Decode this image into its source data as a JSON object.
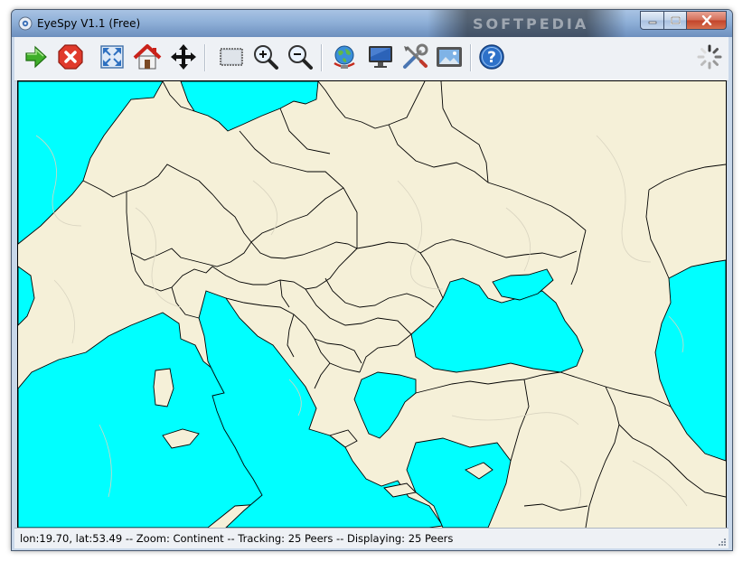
{
  "window": {
    "title": "EyeSpy V1.1 (Free)"
  },
  "watermark": "SOFTPEDIA",
  "toolbar": {
    "buttons": [
      {
        "name": "start",
        "icon": "green-arrow-right-icon"
      },
      {
        "name": "stop",
        "icon": "red-x-icon"
      },
      {
        "name": "full-extent",
        "icon": "expand-icon"
      },
      {
        "name": "home",
        "icon": "home-icon"
      },
      {
        "name": "pan",
        "icon": "move-arrows-icon"
      },
      {
        "name": "select",
        "icon": "rectangle-select-icon"
      },
      {
        "name": "zoom-in",
        "icon": "zoom-in-icon"
      },
      {
        "name": "zoom-out",
        "icon": "zoom-out-icon"
      },
      {
        "name": "network",
        "icon": "globe-network-icon"
      },
      {
        "name": "display",
        "icon": "monitor-icon"
      },
      {
        "name": "settings",
        "icon": "tools-icon"
      },
      {
        "name": "screenshot",
        "icon": "picture-icon"
      },
      {
        "name": "help",
        "icon": "help-icon"
      }
    ],
    "busy_indicator": "spinner-icon"
  },
  "map": {
    "region": "Europe",
    "water_color": "#00ffff",
    "land_color": "#f5f0d8",
    "border_color": "#000000"
  },
  "statusbar": {
    "text": "lon:19.70, lat:53.49 -- Zoom: Continent -- Tracking: 25 Peers -- Displaying: 25 Peers"
  }
}
